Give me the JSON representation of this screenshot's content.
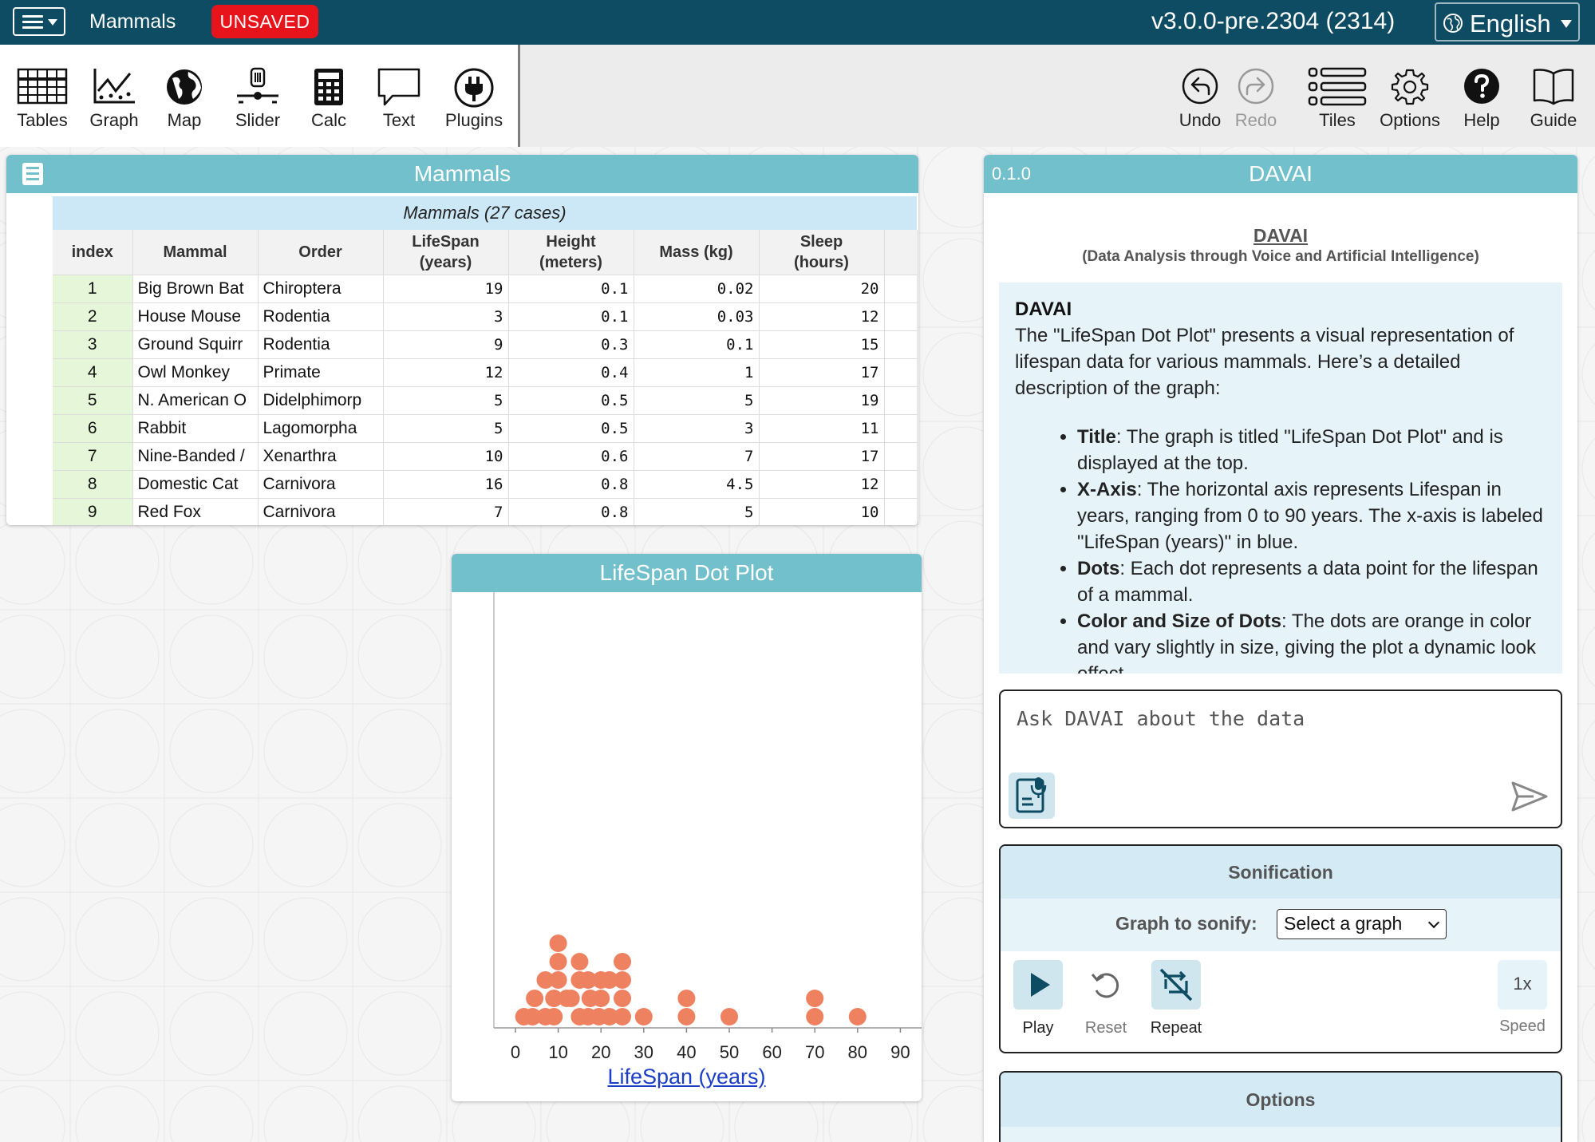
{
  "topbar": {
    "doc_title": "Mammals",
    "unsaved_badge": "UNSAVED",
    "version": "v3.0.0-pre.2304 (2314)",
    "language": "English"
  },
  "toolbar": {
    "left_tools": [
      {
        "label": "Tables",
        "icon": "table-icon"
      },
      {
        "label": "Graph",
        "icon": "graph-icon"
      },
      {
        "label": "Map",
        "icon": "globe-icon"
      },
      {
        "label": "Slider",
        "icon": "slider-icon"
      },
      {
        "label": "Calc",
        "icon": "calculator-icon"
      },
      {
        "label": "Text",
        "icon": "speech-bubble-icon"
      },
      {
        "label": "Plugins",
        "icon": "plug-icon"
      }
    ],
    "right_tools": [
      {
        "label": "Undo",
        "icon": "undo-icon",
        "enabled": true
      },
      {
        "label": "Redo",
        "icon": "redo-icon",
        "enabled": false
      },
      {
        "label": "Tiles",
        "icon": "list-icon",
        "enabled": true
      },
      {
        "label": "Options",
        "icon": "gear-icon",
        "enabled": true
      },
      {
        "label": "Help",
        "icon": "help-icon",
        "enabled": true
      },
      {
        "label": "Guide",
        "icon": "book-icon",
        "enabled": true
      }
    ]
  },
  "table": {
    "title": "Mammals",
    "caption": "Mammals (27 cases)",
    "columns": [
      "index",
      "Mammal",
      "Order",
      "LifeSpan\n(years)",
      "Height\n(meters)",
      "Mass (kg)",
      "Sleep\n(hours)"
    ],
    "rows": [
      [
        "1",
        "Big Brown Bat",
        "Chiroptera",
        "19",
        "0.1",
        "0.02",
        "20"
      ],
      [
        "2",
        "House Mouse",
        "Rodentia",
        "3",
        "0.1",
        "0.03",
        "12"
      ],
      [
        "3",
        "Ground Squirr",
        "Rodentia",
        "9",
        "0.3",
        "0.1",
        "15"
      ],
      [
        "4",
        "Owl Monkey",
        "Primate",
        "12",
        "0.4",
        "1",
        "17"
      ],
      [
        "5",
        "N. American O",
        "Didelphimorp",
        "5",
        "0.5",
        "5",
        "19"
      ],
      [
        "6",
        "Rabbit",
        "Lagomorpha",
        "5",
        "0.5",
        "3",
        "11"
      ],
      [
        "7",
        "Nine-Banded /",
        "Xenarthra",
        "10",
        "0.6",
        "7",
        "17"
      ],
      [
        "8",
        "Domestic Cat",
        "Carnivora",
        "16",
        "0.8",
        "4.5",
        "12"
      ],
      [
        "9",
        "Red Fox",
        "Carnivora",
        "7",
        "0.8",
        "5",
        "10"
      ]
    ]
  },
  "graph": {
    "title": "LifeSpan Dot Plot",
    "x_label": "LifeSpan (years)"
  },
  "chart_data": {
    "type": "scatter",
    "title": "LifeSpan Dot Plot",
    "xlabel": "LifeSpan (years)",
    "ylabel": "",
    "xlim": [
      -3,
      92
    ],
    "x_ticks": [
      "0",
      "10",
      "20",
      "30",
      "40",
      "50",
      "60",
      "70",
      "80",
      "90"
    ],
    "dot_color": "#ee8160",
    "points": [
      {
        "x": 2,
        "stack": 0
      },
      {
        "x": 4,
        "stack": 0
      },
      {
        "x": 4.5,
        "stack": 1
      },
      {
        "x": 7,
        "stack": 0
      },
      {
        "x": 7,
        "stack": 2
      },
      {
        "x": 9,
        "stack": 0
      },
      {
        "x": 9,
        "stack": 1
      },
      {
        "x": 10,
        "stack": 2
      },
      {
        "x": 10,
        "stack": 3
      },
      {
        "x": 10,
        "stack": 4
      },
      {
        "x": 12,
        "stack": 1
      },
      {
        "x": 13,
        "stack": 1
      },
      {
        "x": 15,
        "stack": 0
      },
      {
        "x": 15,
        "stack": 2
      },
      {
        "x": 15,
        "stack": 3
      },
      {
        "x": 17,
        "stack": 0
      },
      {
        "x": 17,
        "stack": 2
      },
      {
        "x": 17.5,
        "stack": 1
      },
      {
        "x": 19.5,
        "stack": 0
      },
      {
        "x": 20,
        "stack": 1
      },
      {
        "x": 20,
        "stack": 2
      },
      {
        "x": 22,
        "stack": 0
      },
      {
        "x": 22,
        "stack": 2
      },
      {
        "x": 25,
        "stack": 0
      },
      {
        "x": 25,
        "stack": 1
      },
      {
        "x": 25,
        "stack": 2
      },
      {
        "x": 25,
        "stack": 3
      },
      {
        "x": 30,
        "stack": 0
      },
      {
        "x": 40,
        "stack": 0
      },
      {
        "x": 40,
        "stack": 1
      },
      {
        "x": 50,
        "stack": 0
      },
      {
        "x": 70,
        "stack": 0
      },
      {
        "x": 70,
        "stack": 1
      },
      {
        "x": 80,
        "stack": 0
      }
    ]
  },
  "davai": {
    "version": "0.1.0",
    "title": "DAVAI",
    "link_title": "DAVAI",
    "subtitle": "(Data Analysis through Voice and Artificial Intelligence)",
    "speaker": "DAVAI",
    "intro": "The \"LifeSpan Dot Plot\" presents a visual representation of lifespan data for various mammals. Here’s a detailed description of the graph:",
    "bullets": [
      {
        "term": "Title",
        "text": ": The graph is titled \"LifeSpan Dot Plot\" and is displayed at the top."
      },
      {
        "term": "X-Axis",
        "text": ": The horizontal axis represents Lifespan in years, ranging from 0 to 90 years. The x-axis is labeled \"LifeSpan (years)\" in blue."
      },
      {
        "term": "Dots",
        "text": ": Each dot represents a data point for the lifespan of a mammal."
      },
      {
        "term": "Color and Size of Dots",
        "text": ": The dots are orange in color and vary slightly in size, giving the plot a dynamic look effect."
      }
    ],
    "ask_placeholder": "Ask DAVAI about the data",
    "sonification": {
      "heading": "Sonification",
      "graph_label": "Graph to sonify:",
      "graph_select_value": "Select a graph",
      "play_label": "Play",
      "reset_label": "Reset",
      "repeat_label": "Repeat",
      "speed_value": "1x",
      "speed_label": "Speed"
    },
    "options_heading": "Options"
  },
  "colors": {
    "topbar": "#0e4c63",
    "tile_header": "#72c0cc",
    "unsaved": "#e8141b",
    "dot": "#ee8160",
    "link_blue": "#1a3ec7"
  }
}
